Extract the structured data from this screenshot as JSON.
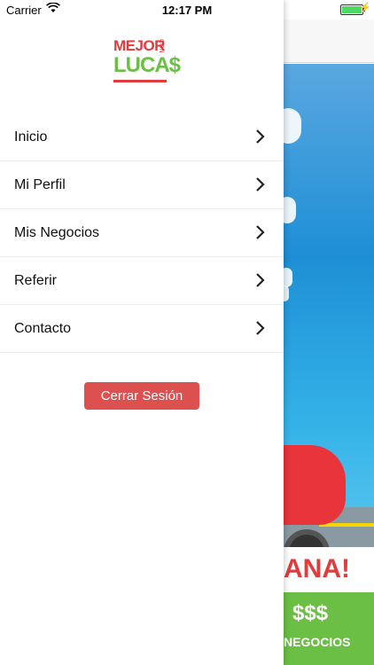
{
  "status_bar": {
    "carrier": "Carrier",
    "time": "12:17 PM"
  },
  "logo": {
    "line1": "MEJOR",
    "con": "CON",
    "line2": "LUCA$"
  },
  "menu": {
    "items": [
      {
        "label": "Inicio"
      },
      {
        "label": "Mi Perfil"
      },
      {
        "label": "Mis Negocios"
      },
      {
        "label": "Referir"
      },
      {
        "label": "Contacto"
      }
    ]
  },
  "logout_label": "Cerrar Sesión",
  "background": {
    "slogan": "ANA!",
    "footer_money": "$$$",
    "footer_label": "NEGOCIOS"
  },
  "colors": {
    "logout": "#dc5050",
    "brand_red": "#e23b3b",
    "brand_green": "#6bbf44"
  }
}
